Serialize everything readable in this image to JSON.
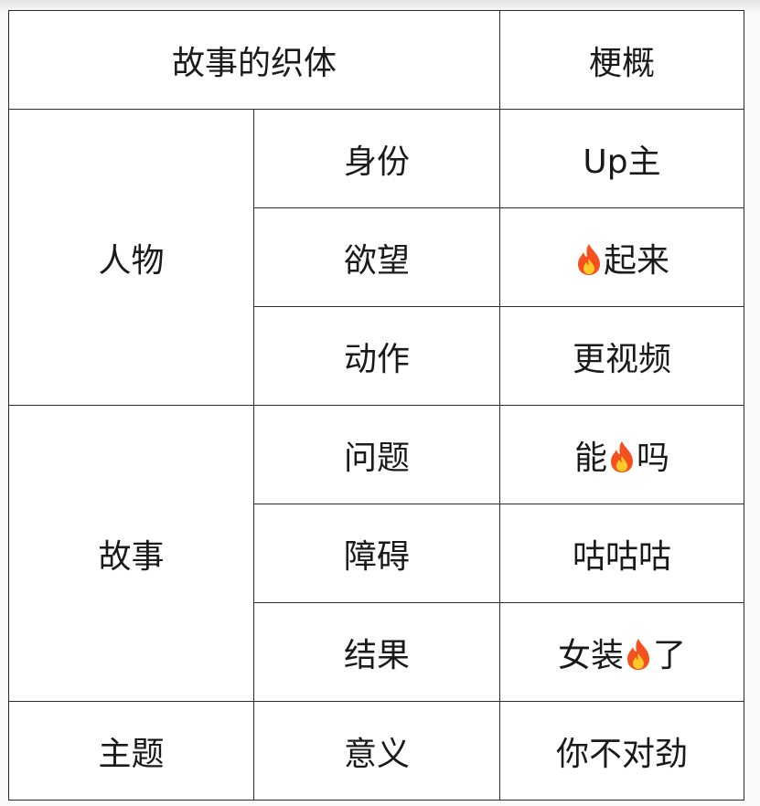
{
  "table": {
    "header": {
      "structure": "故事的织体",
      "synopsis": "梗概"
    },
    "groups": [
      {
        "name": "人物",
        "rows": [
          {
            "item": "身份",
            "synopsis": [
              "Up主"
            ]
          },
          {
            "item": "欲望",
            "synopsis": [
              "",
              "fire",
              "起来"
            ]
          },
          {
            "item": "动作",
            "synopsis": [
              "更视频"
            ]
          }
        ]
      },
      {
        "name": "故事",
        "rows": [
          {
            "item": "问题",
            "synopsis": [
              "能",
              "fire",
              "吗"
            ]
          },
          {
            "item": "障碍",
            "synopsis": [
              "咕咕咕"
            ]
          },
          {
            "item": "结果",
            "synopsis": [
              "女装",
              "fire",
              "了"
            ]
          }
        ]
      },
      {
        "name": "主题",
        "rows": [
          {
            "item": "意义",
            "synopsis": [
              "你不对劲"
            ]
          }
        ]
      }
    ]
  },
  "icons": {
    "fire": "fire-emoji-icon"
  },
  "colors": {
    "border": "#2a2a2a",
    "text": "#1a1a1a",
    "fire_outer": "#f4511e",
    "fire_inner": "#ffca28"
  }
}
